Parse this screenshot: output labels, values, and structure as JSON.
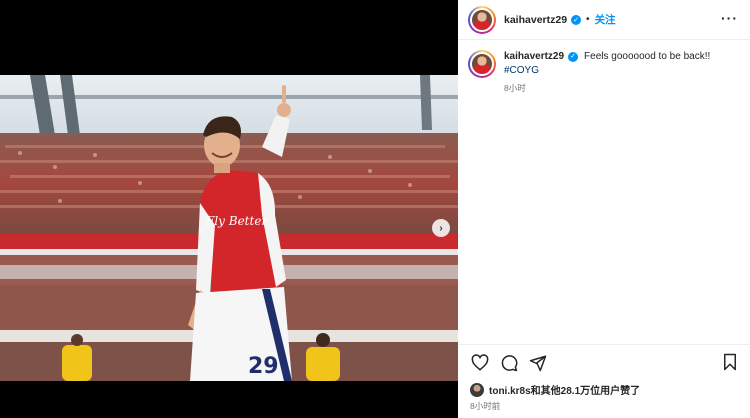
{
  "post": {
    "author": "kaihavertz29",
    "follow_label": "关注",
    "header_separator": "•",
    "caption": "Feels gooooood to be back!!",
    "hashtag": "#COYG",
    "caption_time": "8小时",
    "likes_text": "toni.kr8s和其他28.1万位用户赞了",
    "post_time": "8小时前"
  },
  "photo": {
    "jersey_number": "29",
    "sponsor_text": "Fly Better"
  },
  "icons": {
    "verified": "verified-badge-icon",
    "more": "more-options-icon",
    "like": "heart-icon",
    "comment": "comment-icon",
    "share": "send-icon",
    "save": "bookmark-icon",
    "next": "chevron-right-icon"
  },
  "colors": {
    "accent": "#0095f6",
    "hashtag": "#00376b",
    "arsenal_red": "#d3262b",
    "sky": "#dfe8ef"
  }
}
